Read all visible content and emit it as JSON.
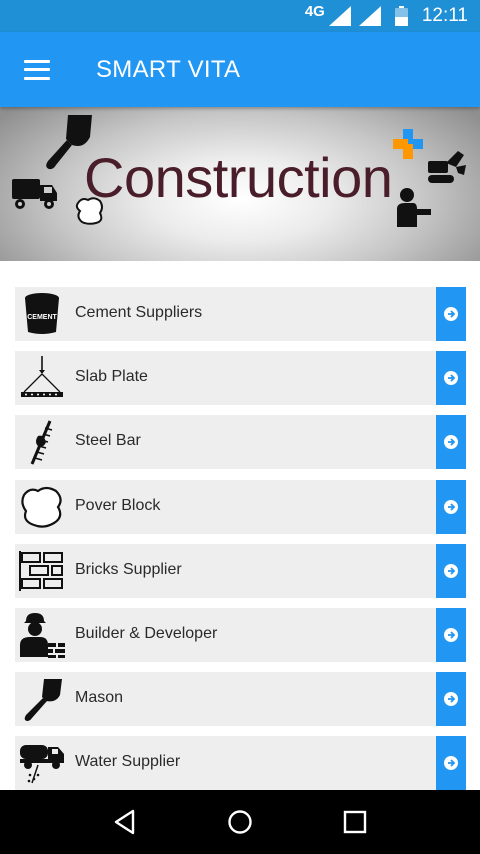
{
  "status_bar": {
    "network": "4G",
    "time": "12:11"
  },
  "app_bar": {
    "title": "SMART VITA"
  },
  "banner": {
    "text": "Construction"
  },
  "categories": [
    {
      "label": "Cement Suppliers",
      "icon": "cement-bag-icon"
    },
    {
      "label": "Slab Plate",
      "icon": "slab-plate-icon"
    },
    {
      "label": "Steel Bar",
      "icon": "steel-bar-icon"
    },
    {
      "label": "Pover Block",
      "icon": "paver-block-icon"
    },
    {
      "label": "Bricks Supplier",
      "icon": "bricks-icon"
    },
    {
      "label": "Builder & Developer",
      "icon": "builder-worker-icon"
    },
    {
      "label": "Mason",
      "icon": "trowel-icon"
    },
    {
      "label": "Water Supplier",
      "icon": "water-tanker-icon"
    }
  ],
  "colors": {
    "primary": "#2196f3",
    "status_bar": "#1f8fd6",
    "row_bg": "#eeeeee",
    "banner_text": "#4a1d2a"
  }
}
